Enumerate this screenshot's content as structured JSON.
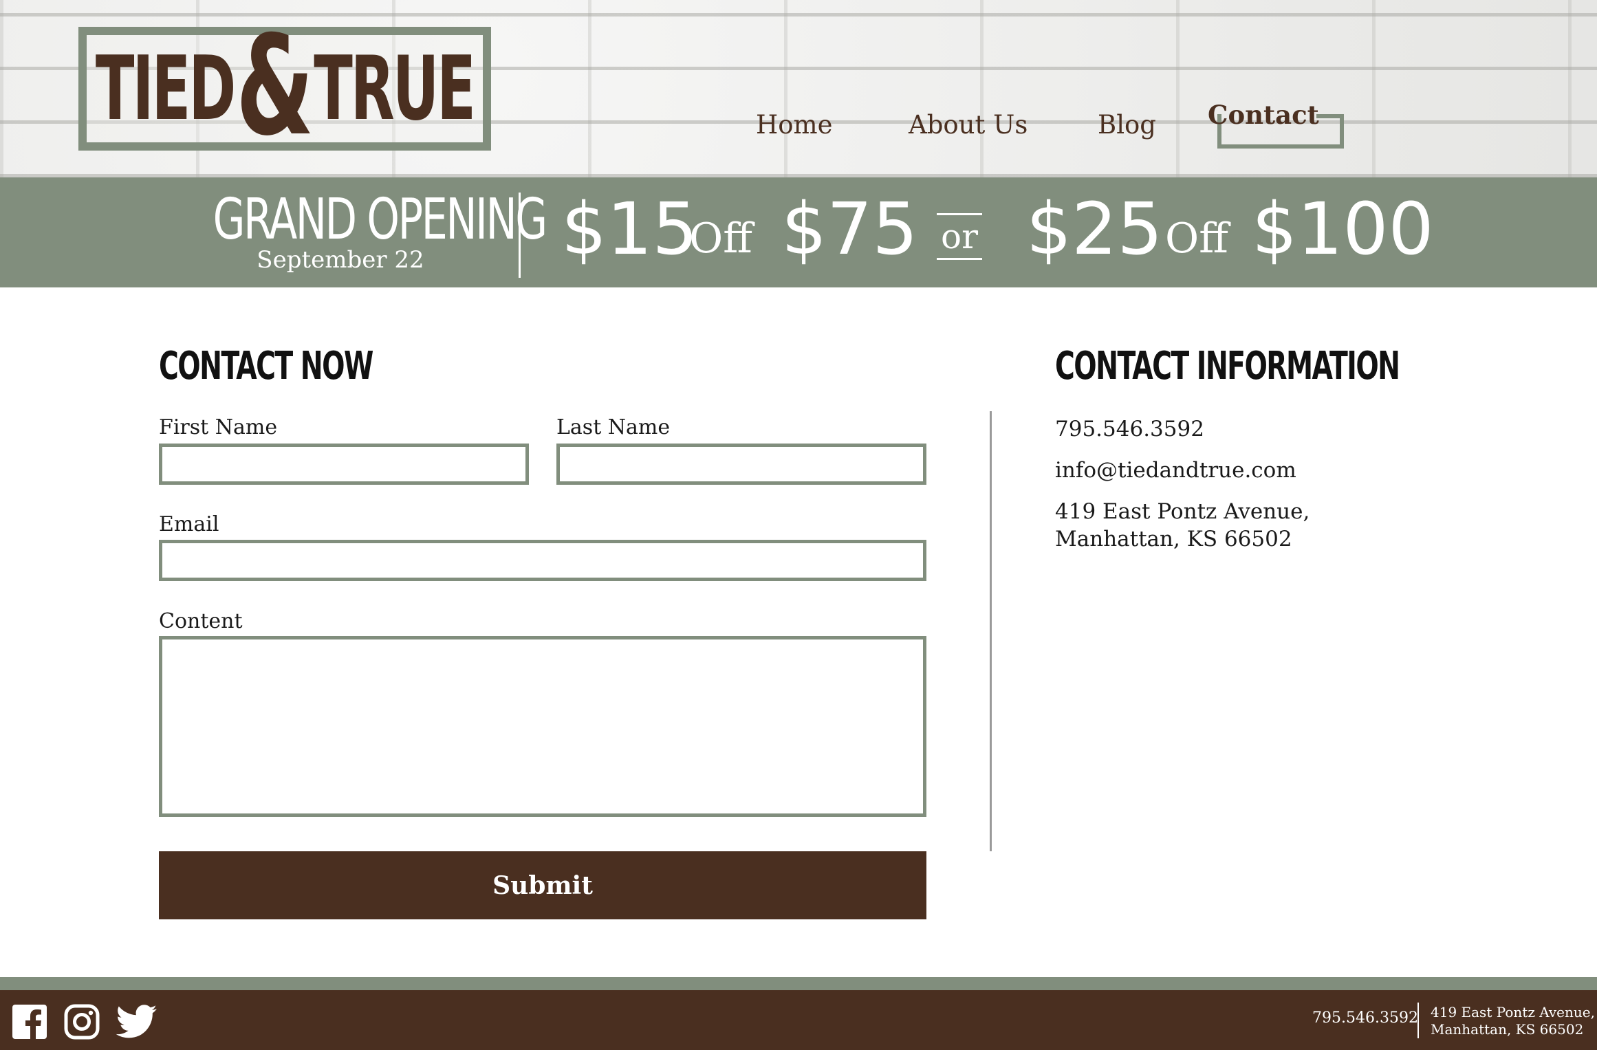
{
  "brand": {
    "logo_left": "TIED",
    "logo_amp": "&",
    "logo_right": "TRUE",
    "colors": {
      "sage": "#818e7d",
      "brown": "#4a2f20",
      "white": "#ffffff"
    }
  },
  "nav": {
    "items": [
      {
        "label": "Home",
        "active": false
      },
      {
        "label": "About Us",
        "active": false
      },
      {
        "label": "Blog",
        "active": false
      },
      {
        "label": "Contact",
        "active": true
      }
    ]
  },
  "banner": {
    "title": "GRAND OPENING",
    "date": "September 22",
    "offer1": {
      "amount": "$15",
      "off": "Off",
      "threshold": "$75"
    },
    "separator": "or",
    "offer2": {
      "amount": "$25",
      "off": "Off",
      "threshold": "$100"
    }
  },
  "form": {
    "heading": "CONTACT NOW",
    "first_name_label": "First Name",
    "last_name_label": "Last Name",
    "email_label": "Email",
    "content_label": "Content",
    "first_name_value": "",
    "last_name_value": "",
    "email_value": "",
    "content_value": "",
    "submit_label": "Submit"
  },
  "info": {
    "heading": "CONTACT INFORMATION",
    "phone": "795.546.3592",
    "email": "info@tiedandtrue.com",
    "address_line1": "419 East Pontz Avenue,",
    "address_line2": "Manhattan, KS 66502"
  },
  "footer": {
    "social": [
      "facebook-icon",
      "instagram-icon",
      "twitter-icon"
    ],
    "phone": "795.546.3592",
    "address_line1": "419 East Pontz Avenue,",
    "address_line2": "Manhattan, KS 66502"
  }
}
